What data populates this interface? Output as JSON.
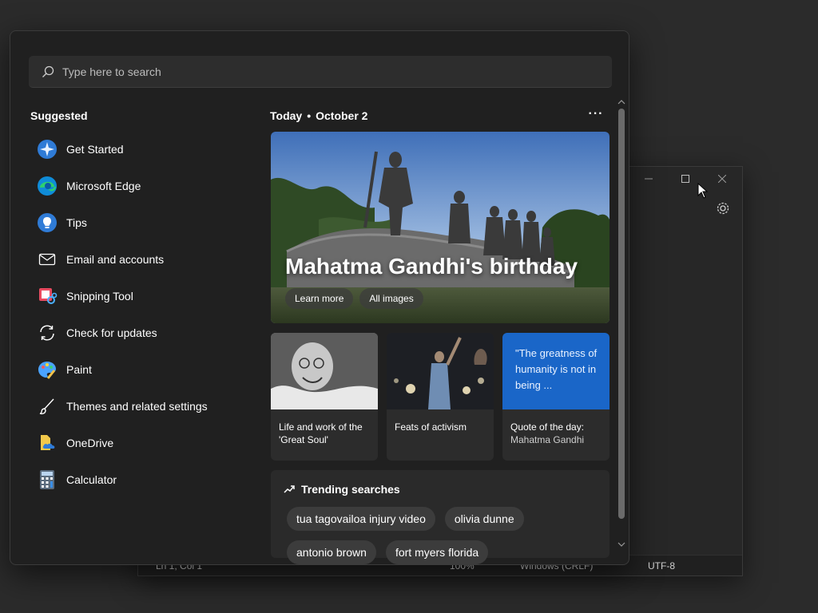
{
  "search": {
    "placeholder": "Type here to search"
  },
  "suggested": {
    "title": "Suggested",
    "items": [
      {
        "label": "Get Started",
        "icon": "get-started-icon"
      },
      {
        "label": "Microsoft Edge",
        "icon": "edge-icon"
      },
      {
        "label": "Tips",
        "icon": "tips-icon"
      },
      {
        "label": "Email and accounts",
        "icon": "mail-icon"
      },
      {
        "label": "Snipping Tool",
        "icon": "snipping-tool-icon"
      },
      {
        "label": "Check for updates",
        "icon": "refresh-icon"
      },
      {
        "label": "Paint",
        "icon": "paint-icon"
      },
      {
        "label": "Themes and related settings",
        "icon": "brush-icon"
      },
      {
        "label": "OneDrive",
        "icon": "onedrive-icon"
      },
      {
        "label": "Calculator",
        "icon": "calculator-icon"
      }
    ]
  },
  "today": {
    "label": "Today",
    "date": "October 2",
    "more": "···",
    "hero": {
      "title": "Mahatma Gandhi's birthday",
      "buttons": [
        "Learn more",
        "All images"
      ]
    },
    "cards": [
      {
        "caption": "Life and work of the 'Great Soul'"
      },
      {
        "caption": "Feats of activism"
      },
      {
        "quote": "\"The greatness of humanity is not in being ...",
        "caption": "Quote of the day:",
        "subcaption": "Mahatma Gandhi"
      }
    ],
    "trending": {
      "title": "Trending searches",
      "chips": [
        "tua tagovailoa injury video",
        "olivia dunne",
        "antonio brown",
        "fort myers florida"
      ]
    }
  },
  "notepad": {
    "status": {
      "position": "Ln 1, Col 1",
      "zoom": "100%",
      "line_endings": "Windows (CRLF)",
      "encoding": "UTF-8"
    }
  },
  "colors": {
    "accent": "#1a66c8",
    "background": "#202020"
  }
}
